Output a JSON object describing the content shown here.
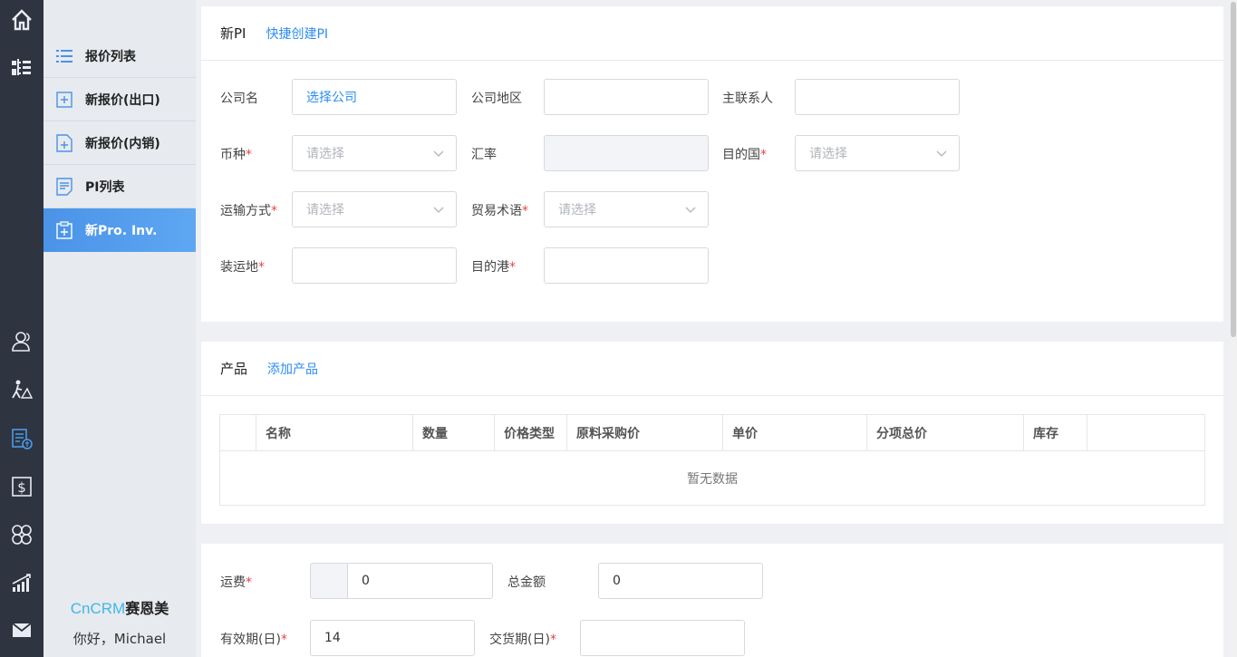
{
  "rail": {
    "icons": [
      "home-icon",
      "org-chart-icon",
      "customers-icon",
      "pipeline-icon",
      "quote-icon",
      "finance-icon",
      "apps-icon",
      "report-icon",
      "mail-icon"
    ]
  },
  "submenu": {
    "items": [
      {
        "label": "报价列表",
        "icon": "list-icon"
      },
      {
        "label": "新报价(出口)",
        "icon": "add-doc-icon"
      },
      {
        "label": "新报价(内销)",
        "icon": "add-file-icon"
      },
      {
        "label": "PI列表",
        "icon": "document-icon"
      },
      {
        "label": "新Pro. Inv.",
        "icon": "clipboard-add-icon"
      }
    ],
    "brand_primary": "CnCRM",
    "brand_secondary": "赛恩美",
    "greeting": "你好，Michael"
  },
  "pi_form": {
    "title": "新PI",
    "quick_link": "快捷创建PI",
    "company_label": "公司名",
    "company_value": "选择公司",
    "region_label": "公司地区",
    "region_value": "",
    "contact_label": "主联系人",
    "contact_value": "",
    "currency_label": "币种",
    "currency_placeholder": "请选择",
    "rate_label": "汇率",
    "rate_value": "",
    "dest_country_label": "目的国",
    "dest_country_placeholder": "请选择",
    "shipping_label": "运输方式",
    "shipping_placeholder": "请选择",
    "trade_term_label": "贸易术语",
    "trade_term_placeholder": "请选择",
    "loading_label": "装运地",
    "loading_value": "",
    "dest_port_label": "目的港",
    "dest_port_value": "",
    "required_mark": "*"
  },
  "products": {
    "title": "产品",
    "add_link": "添加产品",
    "columns": [
      "",
      "名称",
      "数量",
      "价格类型",
      "原料采购价",
      "单价",
      "分项总价",
      "库存",
      ""
    ],
    "empty_text": "暂无数据"
  },
  "totals": {
    "freight_label": "运费",
    "freight_value": "0",
    "total_label": "总金额",
    "total_value": "0",
    "validity_label": "有效期(日)",
    "validity_value": "14",
    "delivery_label": "交货期(日)",
    "delivery_value": ""
  },
  "colors": {
    "accent": "#2d8cf0",
    "rail": "#2e3440",
    "active_item": "#4a93e8",
    "required": "#e64545"
  }
}
